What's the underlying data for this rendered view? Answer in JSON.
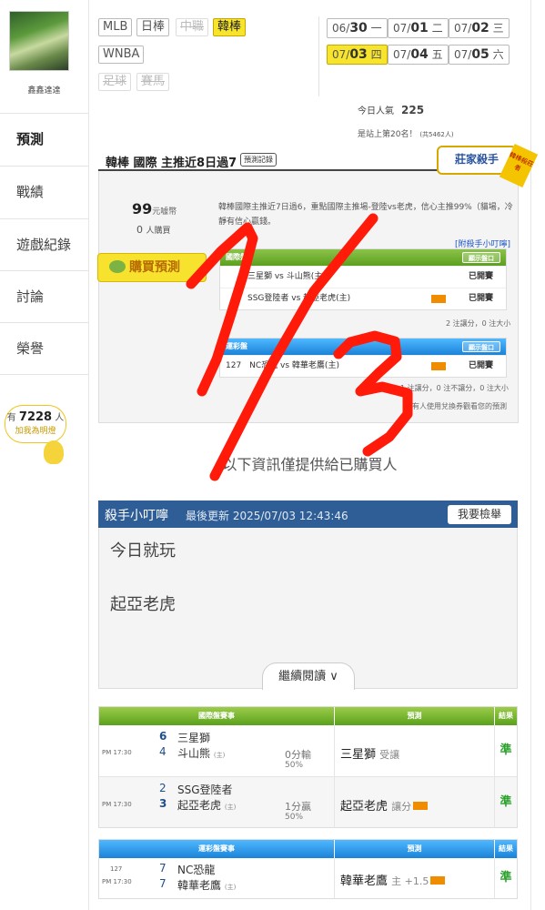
{
  "sidebar": {
    "username": "鑫鑫達達",
    "nav": [
      "預測",
      "戰績",
      "遊戲紀錄",
      "討論",
      "榮譽"
    ],
    "fans_prefix": "有",
    "fans_count": "7228",
    "fans_suffix": "人",
    "fans_cta": "加我為明燈"
  },
  "sports_tabs": [
    {
      "label": "MLB",
      "state": "normal"
    },
    {
      "label": "日棒",
      "state": "normal"
    },
    {
      "label": "中職",
      "state": "disabled"
    },
    {
      "label": "韓棒",
      "state": "active"
    },
    {
      "label": "WNBA",
      "state": "normal"
    },
    {
      "label": "足球",
      "state": "disabled"
    },
    {
      "label": "賽馬",
      "state": "disabled"
    }
  ],
  "dates": [
    {
      "md": "06/",
      "d": "30",
      "wd": "一",
      "active": false
    },
    {
      "md": "07/",
      "d": "01",
      "wd": "二",
      "active": false
    },
    {
      "md": "07/",
      "d": "02",
      "wd": "三",
      "active": false
    },
    {
      "md": "07/",
      "d": "03",
      "wd": "四",
      "active": true
    },
    {
      "md": "07/",
      "d": "04",
      "wd": "五",
      "active": false
    },
    {
      "md": "07/",
      "d": "05",
      "wd": "六",
      "active": false
    }
  ],
  "stats": {
    "popularity_label": "今日人氣",
    "popularity": "225",
    "rank_text": "是站上第20名！",
    "rank_note": "(共5462人)"
  },
  "card": {
    "title": "韓棒 國際 主推近8日過7",
    "record_btn": "預測記錄",
    "badge": "莊家殺手",
    "badge_sub": "韓棒殺莊者",
    "price": "99",
    "price_unit": "元噱幣",
    "buyers": "0",
    "buyers_unit": "人購買",
    "desc": "韓棒國際主推近7日過6，重點國際主推場-登陸vs老虎，信心主推99%（貓場，冷靜有信心贏錢。",
    "tip_link": "[附殺手小叮嚀]",
    "buy_label": "購買預測",
    "intl_head": "國際盤",
    "show_btn": "顯示盤口",
    "intl_rows": [
      {
        "match": "三星獅 vs 斗山熊(主)",
        "status": "已開賽"
      },
      {
        "match": "SSG登陸者 vs 起亞老虎(主)",
        "status": "已開賽"
      }
    ],
    "intl_note": "2 注讓分，0 注大小",
    "lottery_head": "運彩盤",
    "lottery_rows": [
      {
        "match": "127　NC恐龍 vs 韓華老鷹(主)",
        "status": "已開賽"
      }
    ],
    "lottery_note": "1 注讓分，0 注不讓分，0 注大小",
    "lottery_note2": "所有人使用兌換券觀看您的預測"
  },
  "info_msg": "以下資訊僅提供給已購買人",
  "tipster": {
    "name": "殺手小叮嚀",
    "updated": "最後更新 2025/07/03 12:43:46",
    "report_btn": "我要檢舉",
    "line1": "今日就玩",
    "line2": "起亞老虎",
    "more_btn": "繼續閱讀 ∨"
  },
  "intl_table": {
    "headers": [
      "國際盤賽事",
      "預測",
      "結果"
    ],
    "rows": [
      {
        "time": "PM 17:30",
        "n1": "6",
        "t1": "三星獅",
        "n2": "4",
        "t2": "斗山熊",
        "home": "(主)",
        "spread": "0分輸",
        "pct": "50%",
        "pick": "三星獅",
        "pick_note": "受讓",
        "result": "準"
      },
      {
        "time": "PM 17:30",
        "n1": "2",
        "t1": "SSG登陸者",
        "n2": "3",
        "t2": "起亞老虎",
        "home": "(主)",
        "spread": "1分贏",
        "pct": "50%",
        "pick": "起亞老虎",
        "pick_note": "讓分",
        "result": "準"
      }
    ]
  },
  "lottery_table": {
    "headers": [
      "運彩盤賽事",
      "預測",
      "結果"
    ],
    "rows": [
      {
        "code": "127",
        "time": "PM 17:30",
        "n1": "7",
        "t1": "NC恐龍",
        "n2": "7",
        "t2": "韓華老鷹",
        "home": "(主)",
        "pick": "韓華老鷹",
        "pick_note": "主 +1.5",
        "result": "準"
      }
    ]
  },
  "colors": {
    "accent_yellow": "#f7e52d",
    "green_head": "#5aa11c",
    "blue_head": "#1b83d8",
    "tip_header": "#2f5e96",
    "scribble": "#ff1a0a",
    "win": "#2aa12a"
  }
}
